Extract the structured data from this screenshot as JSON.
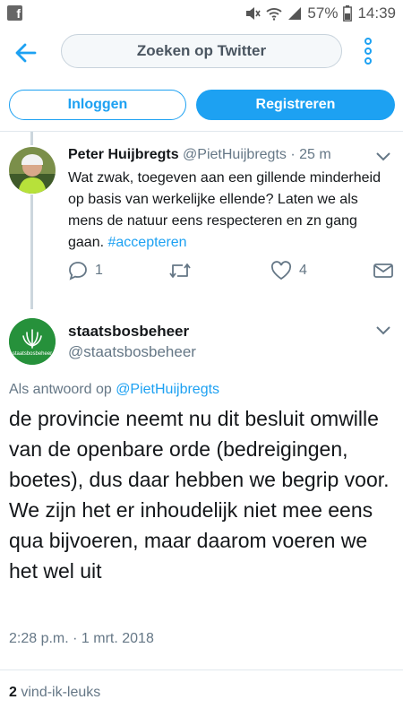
{
  "status_bar": {
    "app_icon": "facebook-icon",
    "battery": "57%",
    "time": "14:39",
    "icons": [
      "mute-icon",
      "wifi-icon",
      "signal-icon",
      "battery-icon"
    ]
  },
  "topbar": {
    "back_icon": "back-arrow-icon",
    "search_label": "Zoeken op Twitter",
    "more_icon": "more-vertical-icon"
  },
  "auth": {
    "login_label": "Inloggen",
    "register_label": "Registreren"
  },
  "parent_tweet": {
    "name": "Peter Huijbregts",
    "handle": "@PietHuijbregts",
    "separator": "·",
    "time": "25 m",
    "text": "Wat zwak, toegeven aan een gillende minderheid op basis van werkelijke ellende? Laten we als mens de natuur eens respecteren en zn gang gaan.",
    "hashtag": "#accepteren",
    "reply_count": "1",
    "retweet_count": "",
    "like_count": "4"
  },
  "main_tweet": {
    "avatar_text": "staatsbosbeheer",
    "name": "staatsbosbeheer",
    "handle": "@staatsbosbeheer",
    "reply_prefix": "Als antwoord op",
    "reply_mention": "@PietHuijbregts",
    "text": "de provincie neemt nu dit besluit omwille van de openbare orde (bedreigingen, boetes), dus daar hebben we begrip voor. We zijn het er inhoudelijk niet mee eens qua bijvoeren, maar daarom voeren we het wel uit",
    "timestamp": "2:28 p.m. · 1 mrt. 2018",
    "likes_count": "2",
    "likes_label": "vind-ik-leuks"
  },
  "colors": {
    "accent": "#1da1f2",
    "text": "#14171a",
    "muted": "#657786",
    "brand_green": "#26913b"
  }
}
